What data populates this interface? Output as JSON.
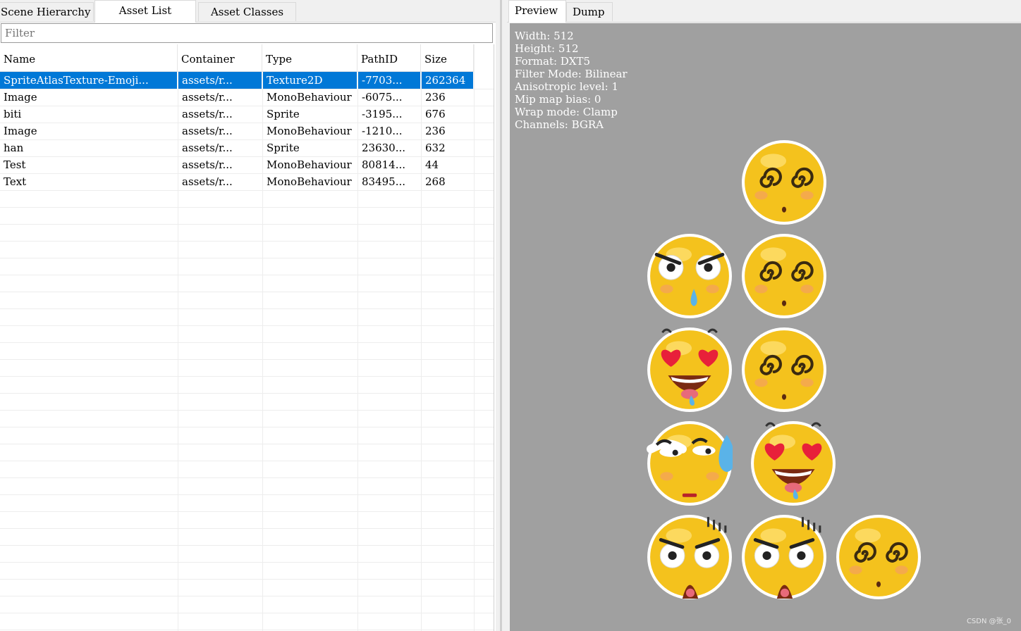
{
  "left_tabs": {
    "scene_hierarchy": "Scene Hierarchy",
    "asset_list": "Asset List",
    "asset_classes": "Asset Classes"
  },
  "filter": {
    "placeholder": "Filter"
  },
  "table": {
    "headers": [
      "Name",
      "Container",
      "Type",
      "PathID",
      "Size"
    ],
    "rows": [
      {
        "name": "SpriteAtlasTexture-Emoji...",
        "container": "assets/r...",
        "type": "Texture2D",
        "path_id": "-7703...",
        "size": "262364",
        "selected": true
      },
      {
        "name": "Image",
        "container": "assets/r...",
        "type": "MonoBehaviour",
        "path_id": "-6075...",
        "size": "236"
      },
      {
        "name": "biti",
        "container": "assets/r...",
        "type": "Sprite",
        "path_id": "-3195...",
        "size": "676"
      },
      {
        "name": "Image",
        "container": "assets/r...",
        "type": "MonoBehaviour",
        "path_id": "-1210...",
        "size": "236"
      },
      {
        "name": "han",
        "container": "assets/r...",
        "type": "Sprite",
        "path_id": "23630...",
        "size": "632"
      },
      {
        "name": "Test",
        "container": "assets/r...",
        "type": "MonoBehaviour",
        "path_id": "80814...",
        "size": "44"
      },
      {
        "name": "Text",
        "container": "assets/r...",
        "type": "MonoBehaviour",
        "path_id": "83495...",
        "size": "268"
      }
    ]
  },
  "right_tabs": {
    "preview": "Preview",
    "dump": "Dump"
  },
  "texture_info": [
    "Width: 512",
    "Height: 512",
    "Format: DXT5",
    "Filter Mode: Bilinear",
    "Anisotropic level: 1",
    "Mip map bias: 0",
    "Wrap mode: Clamp",
    "Channels: BGRA"
  ],
  "sprites": [
    {
      "kind": "dizzy"
    },
    {
      "kind": "angry-sweat"
    },
    {
      "kind": "dizzy"
    },
    {
      "kind": "heart-eyes"
    },
    {
      "kind": "dizzy"
    },
    {
      "kind": "sweat-meh"
    },
    {
      "kind": "heart-eyes"
    },
    {
      "kind": "shocked"
    },
    {
      "kind": "shocked"
    },
    {
      "kind": "dizzy"
    }
  ],
  "colors": {
    "selection": "#0078d7",
    "preview_bg": "#a0a0a0",
    "emoji_face": "#f4c21d"
  },
  "watermark": "CSDN @张_0"
}
